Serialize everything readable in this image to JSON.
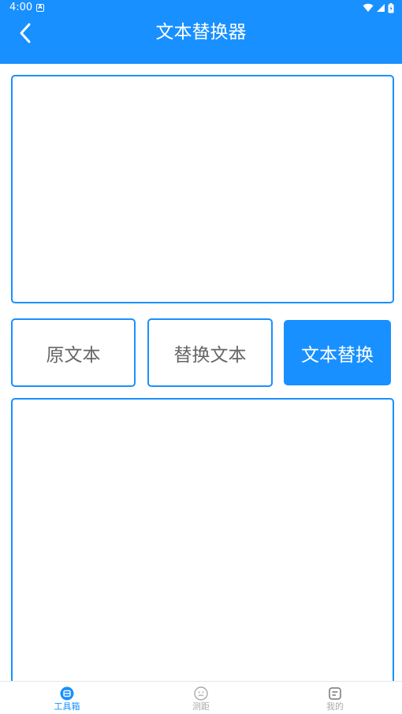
{
  "status_bar": {
    "time": "4:00",
    "a_badge": "A"
  },
  "header": {
    "title": "文本替换器",
    "back_icon": "chevron-left-icon"
  },
  "source_input": {
    "value": "",
    "placeholder": ""
  },
  "buttons": {
    "original_text": "原文本",
    "replace_text": "替换文本",
    "do_replace": "文本替换"
  },
  "result_output": {
    "value": "",
    "placeholder": ""
  },
  "tab_bar": {
    "items": [
      {
        "label": "工具箱",
        "icon": "toolbox-icon",
        "active": true
      },
      {
        "label": "测距",
        "icon": "face-icon",
        "active": false
      },
      {
        "label": "我的",
        "icon": "note-icon",
        "active": false
      }
    ]
  },
  "colors": {
    "primary": "#1890ff",
    "inactive": "#aaaaaa",
    "button_text": "#666666"
  }
}
